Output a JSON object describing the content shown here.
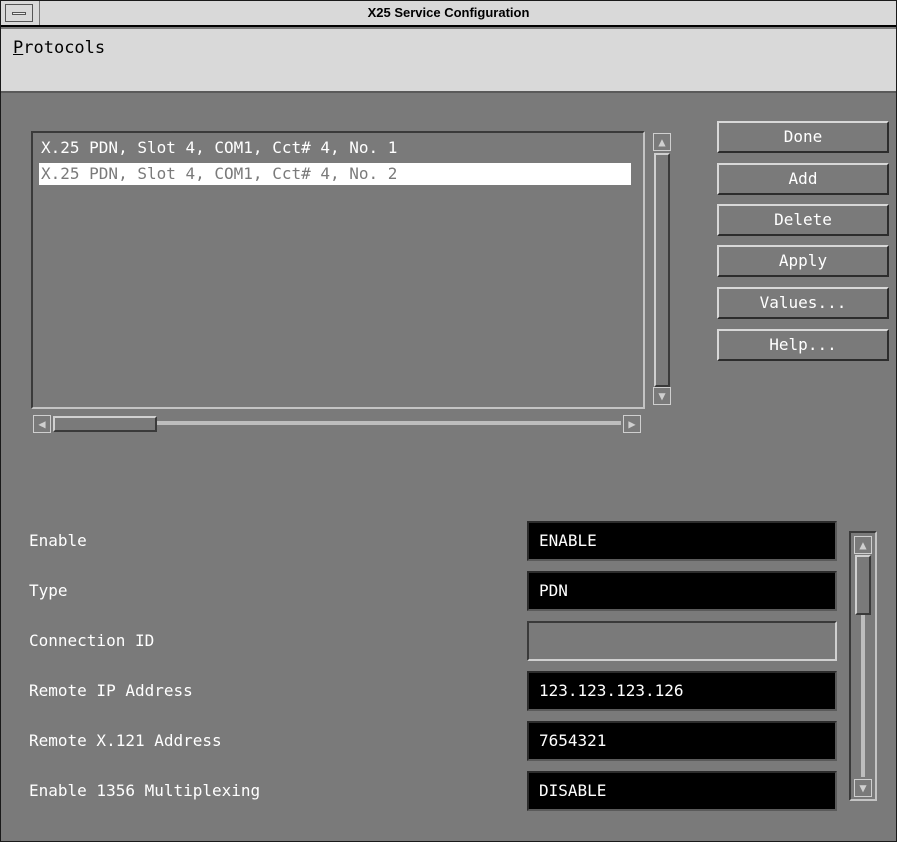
{
  "window": {
    "title": "X25 Service Configuration"
  },
  "menubar": {
    "protocols_mnemonic": "P",
    "protocols_rest": "rotocols"
  },
  "list": {
    "items": [
      "X.25 PDN, Slot 4, COM1, Cct# 4, No. 1",
      "X.25 PDN, Slot 4, COM1, Cct# 4, No. 2"
    ],
    "selected_index": 1
  },
  "buttons": {
    "done": "Done",
    "add": "Add",
    "delete": "Delete",
    "apply": "Apply",
    "values": "Values...",
    "help": "Help..."
  },
  "fields": [
    {
      "label": "Enable",
      "value": "ENABLE"
    },
    {
      "label": "Type",
      "value": "PDN"
    },
    {
      "label": "Connection ID",
      "value": ""
    },
    {
      "label": "Remote IP Address",
      "value": "123.123.123.126"
    },
    {
      "label": "Remote X.121 Address",
      "value": "7654321"
    },
    {
      "label": "Enable 1356 Multiplexing",
      "value": "DISABLE"
    }
  ],
  "icons": {
    "window_menu": "window-menu-icon",
    "arrow_up": "arrow-up-icon",
    "arrow_down": "arrow-down-icon",
    "arrow_left": "arrow-left-icon",
    "arrow_right": "arrow-right-icon"
  },
  "colors": {
    "background": "#7a7a7a",
    "title_bar": "#d9d9d9",
    "value_field": "#000000",
    "text": "#ffffff"
  }
}
